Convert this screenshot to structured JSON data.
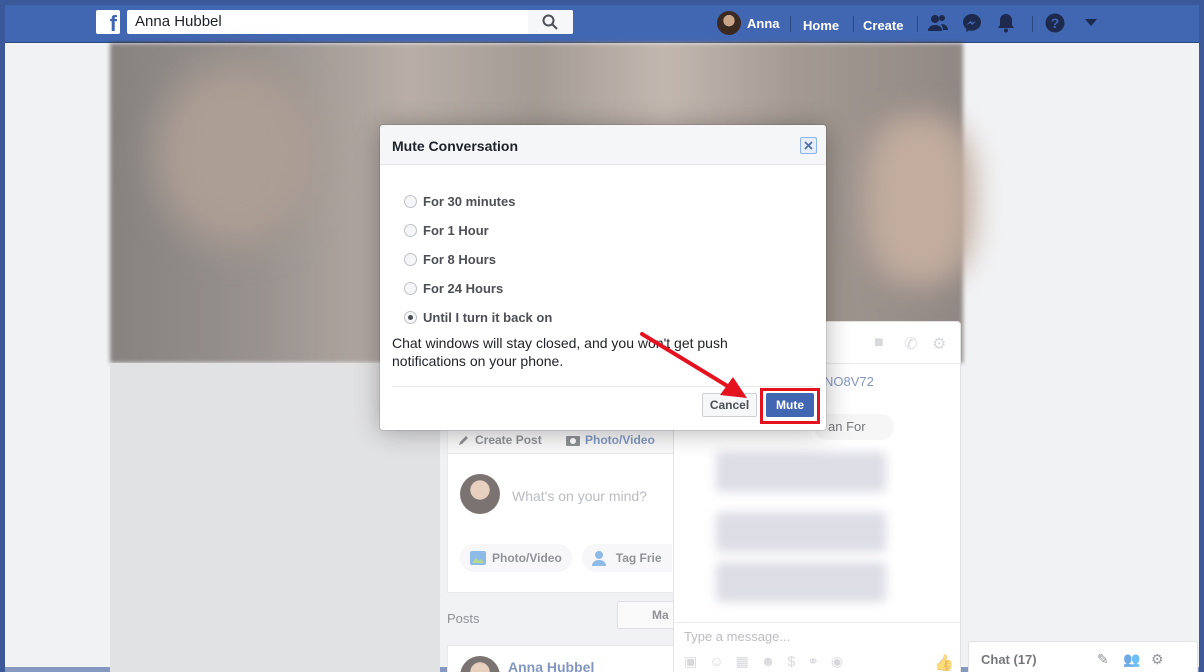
{
  "topbar": {
    "search_value": "Anna Hubbel",
    "user_name": "Anna",
    "nav_home": "Home",
    "nav_create": "Create"
  },
  "composer": {
    "create_post": "Create Post",
    "photo_video_tab": "Photo/Video",
    "placeholder": "What's on your mind?",
    "action_photo": "Photo/Video",
    "action_tag": "Tag Frie"
  },
  "posts": {
    "title": "Posts",
    "manage": "Ma",
    "author": "Anna Hubbel"
  },
  "chat_window": {
    "code": "NO8V72",
    "bubble": "an For",
    "input_placeholder": "Type a message..."
  },
  "chat_dock": {
    "label": "Chat (17)"
  },
  "dialog": {
    "title": "Mute Conversation",
    "options": [
      {
        "label": "For 30 minutes",
        "selected": false
      },
      {
        "label": "For 1 Hour",
        "selected": false
      },
      {
        "label": "For 8 Hours",
        "selected": false
      },
      {
        "label": "For 24 Hours",
        "selected": false
      },
      {
        "label": "Until I turn it back on",
        "selected": true
      }
    ],
    "description": "Chat windows will stay closed, and you won't get push notifications on your phone.",
    "cancel_label": "Cancel",
    "mute_label": "Mute"
  },
  "colors": {
    "brand": "#4267b2",
    "highlight": "#e4121e"
  }
}
